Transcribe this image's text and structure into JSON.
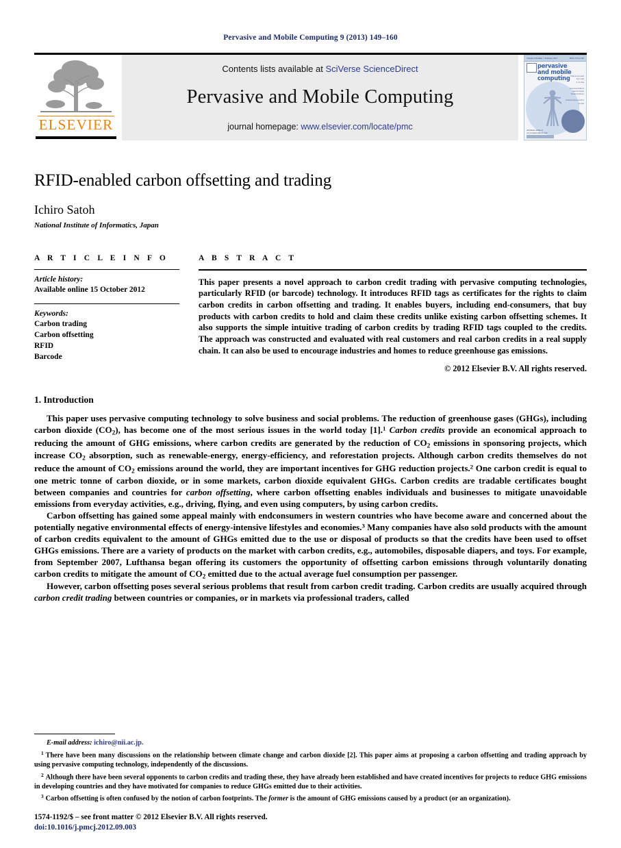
{
  "running_head": "Pervasive and Mobile Computing 9 (2013) 149–160",
  "masthead": {
    "publisher_wordmark": "ELSEVIER",
    "contents_prefix": "Contents lists available at ",
    "contents_link": "SciVerse ScienceDirect",
    "journal_title": "Pervasive and Mobile Computing",
    "homepage_prefix": "journal homepage: ",
    "homepage_link": "www.elsevier.com/locate/pmc",
    "cover": {
      "top_left": "Volume 9 Number 1 February 2013",
      "top_right": "ISSN 1574-1192",
      "title_line1": "pervasive",
      "title_line2": "and mobile",
      "title_line3": "computing",
      "side_lines": "Editors-in-Chief\nM. Conti\nS. K. Das\n\nAssociate Editors\nSpecial Issues\nTechnical Notes\n\nIndexed/Abstracted in\nScopus",
      "foot_text": "Available online at\nwww.sciencedirect.com"
    }
  },
  "article": {
    "title": "RFID-enabled carbon offsetting and trading",
    "author": "Ichiro Satoh",
    "affiliation": "National Institute of Informatics, Japan"
  },
  "article_info": {
    "label": "A R T I C L E   I N F O",
    "history_label": "Article history:",
    "history_value": "Available online 15 October 2012",
    "keywords_label": "Keywords:",
    "keywords": [
      "Carbon trading",
      "Carbon offsetting",
      "RFID",
      "Barcode"
    ]
  },
  "abstract": {
    "label": "A B S T R A C T",
    "text": "This paper presents a novel approach to carbon credit trading with pervasive computing technologies, particularly RFID (or barcode) technology. It introduces RFID tags as certificates for the rights to claim carbon credits in carbon offsetting and trading. It enables buyers, including end-consumers, that buy products with carbon credits to hold and claim these credits unlike existing carbon offsetting schemes. It also supports the simple intuitive trading of carbon credits by trading RFID tags coupled to the credits. The approach was constructed and evaluated with real customers and real carbon credits in a real supply chain. It can also be used to encourage industries and homes to reduce greenhouse gas emissions.",
    "copyright": "© 2012 Elsevier B.V. All rights reserved."
  },
  "body": {
    "section_heading": "1. Introduction",
    "paragraphs": [
      {
        "parts": [
          {
            "t": "This paper uses pervasive computing technology to solve business and social problems. The reduction of greenhouse gases (GHGs), including carbon dioxide (CO"
          },
          {
            "t": "2",
            "style": "sub"
          },
          {
            "t": "), has become one of the most serious issues in the world today [1]."
          },
          {
            "t": "1",
            "style": "sup"
          },
          {
            "t": " Carbon credits",
            "style": "em"
          },
          {
            "t": " provide an economical approach to reducing the amount of GHG emissions, where carbon credits are generated by the reduction of CO"
          },
          {
            "t": "2",
            "style": "sub"
          },
          {
            "t": " emissions in sponsoring projects, which increase CO"
          },
          {
            "t": "2",
            "style": "sub"
          },
          {
            "t": " absorption, such as renewable-energy, energy-efficiency, and reforestation projects. Although carbon credits themselves do not reduce the amount of CO"
          },
          {
            "t": "2",
            "style": "sub"
          },
          {
            "t": " emissions around the world, they are important incentives for GHG reduction projects."
          },
          {
            "t": "2",
            "style": "sup"
          },
          {
            "t": " One carbon credit is equal to one metric tonne of carbon dioxide, or in some markets, carbon dioxide equivalent GHGs. Carbon credits are tradable certificates bought between companies and countries for "
          },
          {
            "t": "carbon offsetting",
            "style": "em"
          },
          {
            "t": ", where carbon offsetting enables individuals and businesses to mitigate unavoidable emissions from everyday activities, e.g., driving, flying, and even using computers, by using carbon credits."
          }
        ]
      },
      {
        "parts": [
          {
            "t": "Carbon offsetting has gained some appeal mainly with endconsumers in western countries who have become aware and concerned about the potentially negative environmental effects of energy-intensive lifestyles and economies."
          },
          {
            "t": "3",
            "style": "sup"
          },
          {
            "t": " Many companies have also sold products with the amount of carbon credits equivalent to the amount of GHGs emitted due to the use or disposal of products so that the credits have been used to offset GHGs emissions. There are a variety of products on the market with carbon credits, e.g., automobiles, disposable diapers, and toys. For example, from September 2007, Lufthansa began offering its customers the opportunity of offsetting carbon emissions through voluntarily donating carbon credits to mitigate the amount of CO"
          },
          {
            "t": "2",
            "style": "sub"
          },
          {
            "t": " emitted due to the actual average fuel consumption per passenger."
          }
        ]
      },
      {
        "parts": [
          {
            "t": "However, carbon offsetting poses several serious problems that result from carbon credit trading. Carbon credits are usually acquired through "
          },
          {
            "t": "carbon credit trading",
            "style": "em"
          },
          {
            "t": " between countries or companies, or in markets via professional traders, called"
          }
        ]
      }
    ]
  },
  "footnotes": {
    "email_label": "E-mail address:",
    "email_value": "ichiro@nii.ac.jp.",
    "items": [
      {
        "number": "1",
        "text": "There have been many discussions on the relationship between climate change and carbon dioxide [2]. This paper aims at proposing a carbon offsetting and trading approach by using pervasive computing technology, independently of the discussions."
      },
      {
        "number": "2",
        "text": "Although there have been several opponents to carbon credits and trading these, they have already been established and have created incentives for projects to reduce GHG emissions in developing countries and they have motivated for companies to reduce GHGs emitted due to their activities."
      },
      {
        "number": "3",
        "parts": [
          {
            "t": "Carbon offsetting is often confused by the notion of carbon footprints. The "
          },
          {
            "t": "former",
            "style": "em"
          },
          {
            "t": " is the amount of GHG emissions caused by a product (or an organization)."
          }
        ]
      }
    ]
  },
  "footer": {
    "front_matter": "1574-1192/$ – see front matter © 2012 Elsevier B.V. All rights reserved.",
    "doi": "doi:10.1016/j.pmcj.2012.09.003"
  },
  "colors": {
    "link": "#2d3b8f",
    "running_head": "#1b2a6b",
    "elsevier_orange": "#f08000",
    "banner_bg": "#ebebeb"
  }
}
